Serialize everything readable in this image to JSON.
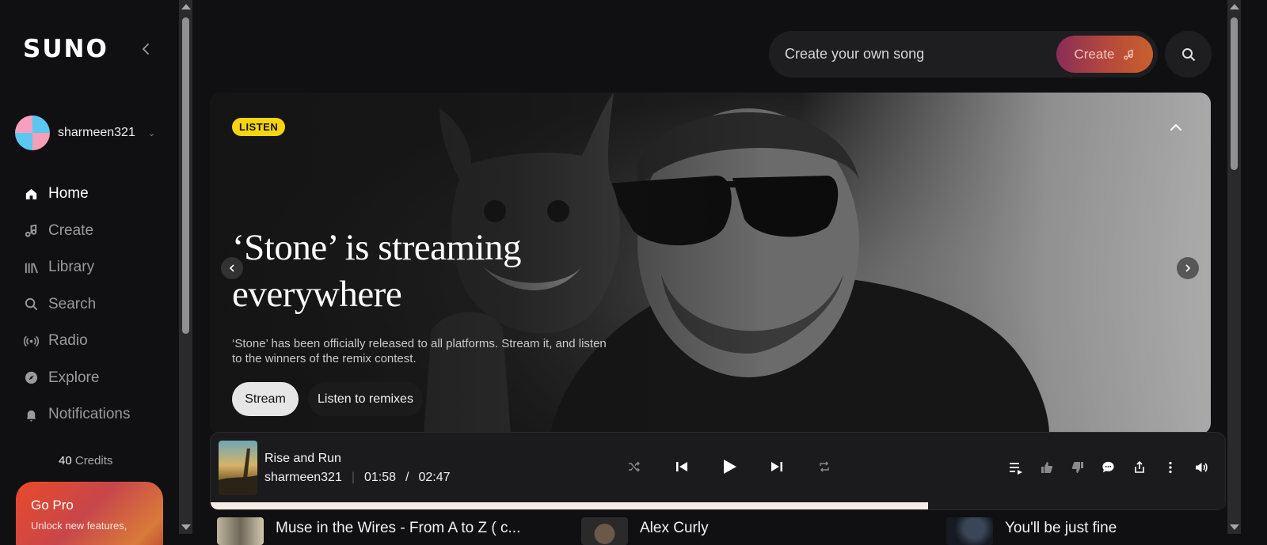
{
  "sidebar": {
    "logo": "SUNO",
    "username": "sharmeen321",
    "nav": [
      {
        "label": "Home",
        "icon": "home-icon",
        "active": true
      },
      {
        "label": "Create",
        "icon": "music-note-icon"
      },
      {
        "label": "Library",
        "icon": "library-icon"
      },
      {
        "label": "Search",
        "icon": "search-icon"
      },
      {
        "label": "Radio",
        "icon": "radio-icon"
      },
      {
        "label": "Explore",
        "icon": "compass-icon"
      },
      {
        "label": "Notifications",
        "icon": "bell-icon"
      }
    ],
    "credits_count": "40",
    "credits_label": "Credits",
    "gopro": {
      "title": "Go Pro",
      "subtitle": "Unlock new features,"
    }
  },
  "topbar": {
    "create_placeholder": "Create your own song",
    "create_button": "Create"
  },
  "hero": {
    "badge": "LISTEN",
    "title": "‘Stone’ is streaming everywhere",
    "description": "‘Stone’ has been officially released to all platforms. Stream it, and listen to the winners of the remix contest.",
    "stream_button": "Stream",
    "remix_button": "Listen to remixes"
  },
  "player": {
    "title": "Rise and Run",
    "artist": "sharmeen321",
    "current_time": "01:58",
    "time_separator": "/",
    "duration": "02:47",
    "progress": 0.706
  },
  "list": [
    {
      "title": "Muse in the Wires - From A to Z ( c..."
    },
    {
      "title": "Alex Curly"
    },
    {
      "title": "You'll be just fine"
    }
  ],
  "colors": {
    "background": "#101012",
    "badge": "#f6d510",
    "create_gradient_start": "#8a2d57",
    "create_gradient_end": "#c9602c",
    "gopro": "#e94a2a"
  }
}
